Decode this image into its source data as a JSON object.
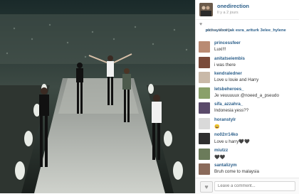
{
  "post": {
    "username": "onedirection",
    "time": "Il y a 2 jours"
  },
  "likes": {
    "icon": "heart-icon",
    "names": "pichayaborijak  esra_ariturk  3elee_hylene",
    "others": "others like this."
  },
  "comments": [
    {
      "user": "princessfeer",
      "text": "Luxi!!!",
      "avatar_color": "#b98b73"
    },
    {
      "user": "anitatseiembis",
      "text": "i was there",
      "avatar_color": "#7a4b3a"
    },
    {
      "user": "kendraledner",
      "text": "Love u louie and Harry",
      "avatar_color": "#c9b9a8"
    },
    {
      "user": "letsbeheroes_",
      "text": "Je veuuuuux @noeed_a_pseudo",
      "avatar_color": "#8aa06a"
    },
    {
      "user": "sifa_azzahra_",
      "text": "Indonesia yess??",
      "avatar_color": "#5a4a6a"
    },
    {
      "user": "horanstylr",
      "text": "😀",
      "avatar_color": "#d9d9d9"
    },
    {
      "user": "no02rr14ko",
      "text": "Love u harry🖤🖤",
      "avatar_color": "#2f2f2f"
    },
    {
      "user": "miutzz",
      "text": "🖤🖤",
      "avatar_color": "#6b7b5a"
    },
    {
      "user": "santalizym",
      "text": "Bruh come to malaysia",
      "avatar_color": "#8a6a5a"
    }
  ],
  "footer": {
    "placeholder": "Leave a comment..."
  }
}
